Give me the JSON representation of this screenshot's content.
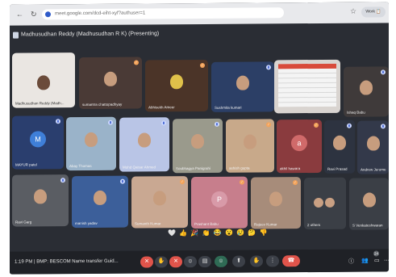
{
  "browser": {
    "url": "meet.google.com/dcd-eiht-xyf?authuser=1",
    "profile_label": "Work 📋"
  },
  "meeting": {
    "presenting_title": "Madhusudhan Reddy (Madhusudhan R K) (Presenting)",
    "time": "1:19 PM",
    "separator": "|",
    "meeting_name": "BMP: BESCOM Name transfer Guid...",
    "people_count": "24"
  },
  "reactions": [
    "🤍",
    "👍",
    "🎉",
    "👏",
    "😂",
    "😮",
    "😢",
    "🤔",
    "👎"
  ],
  "tiles": [
    {
      "name": "Madhusudhan Reddy (Madh...",
      "mic": "none"
    },
    {
      "name": "sumantra chattopadhyay",
      "mic": "orange"
    },
    {
      "name": "Abhisekh Ameer",
      "mic": "orange"
    },
    {
      "name": "Sushmita kumari",
      "mic": "blue"
    },
    {
      "name": "",
      "mic": "none"
    },
    {
      "name": "Ishaq Babu",
      "mic": "blue"
    },
    {
      "name": "MAYUR patel",
      "mic": "blue",
      "initial": "M",
      "color": "#3f7fd8"
    },
    {
      "name": "Abay Thomas",
      "mic": "blue"
    },
    {
      "name": "Mohd Qaisar Ahmed",
      "mic": "blue"
    },
    {
      "name": "Soubhagya Panigrahi",
      "mic": "blue"
    },
    {
      "name": "ashish gupta",
      "mic": "orange"
    },
    {
      "name": "akhil hawara",
      "mic": "orange",
      "initial": "a",
      "color": "#d06a6a"
    },
    {
      "name": "Ravi Prasad",
      "mic": "blue"
    },
    {
      "name": "Andrew Jerome",
      "mic": "blue"
    },
    {
      "name": "Ravi Garg",
      "mic": "blue"
    },
    {
      "name": "manish yadav",
      "mic": "blue"
    },
    {
      "name": "Sumanth Kumar",
      "mic": "orange"
    },
    {
      "name": "Prashant Babu",
      "mic": "orange",
      "initial": "P",
      "color": "#d89aa8"
    },
    {
      "name": "Rajeev Kumar",
      "mic": "orange"
    },
    {
      "name": "2 others",
      "mic": "none"
    },
    {
      "name": "S Venkateshwaran",
      "mic": "none"
    }
  ],
  "controls": [
    {
      "icon": "mic-off-icon",
      "glyph": "✕"
    },
    {
      "icon": "hand-icon",
      "glyph": "✋"
    },
    {
      "icon": "camera-off-icon",
      "glyph": "✕"
    },
    {
      "icon": "emoji-icon",
      "glyph": "☺"
    },
    {
      "icon": "captions-icon",
      "glyph": "▤"
    },
    {
      "icon": "reaction-icon",
      "glyph": "☺"
    },
    {
      "icon": "present-icon",
      "glyph": "⬆"
    },
    {
      "icon": "raise-hand-icon",
      "glyph": "✋"
    },
    {
      "icon": "more-icon",
      "glyph": "⋮"
    },
    {
      "icon": "leave-call-icon",
      "glyph": "☎"
    }
  ]
}
